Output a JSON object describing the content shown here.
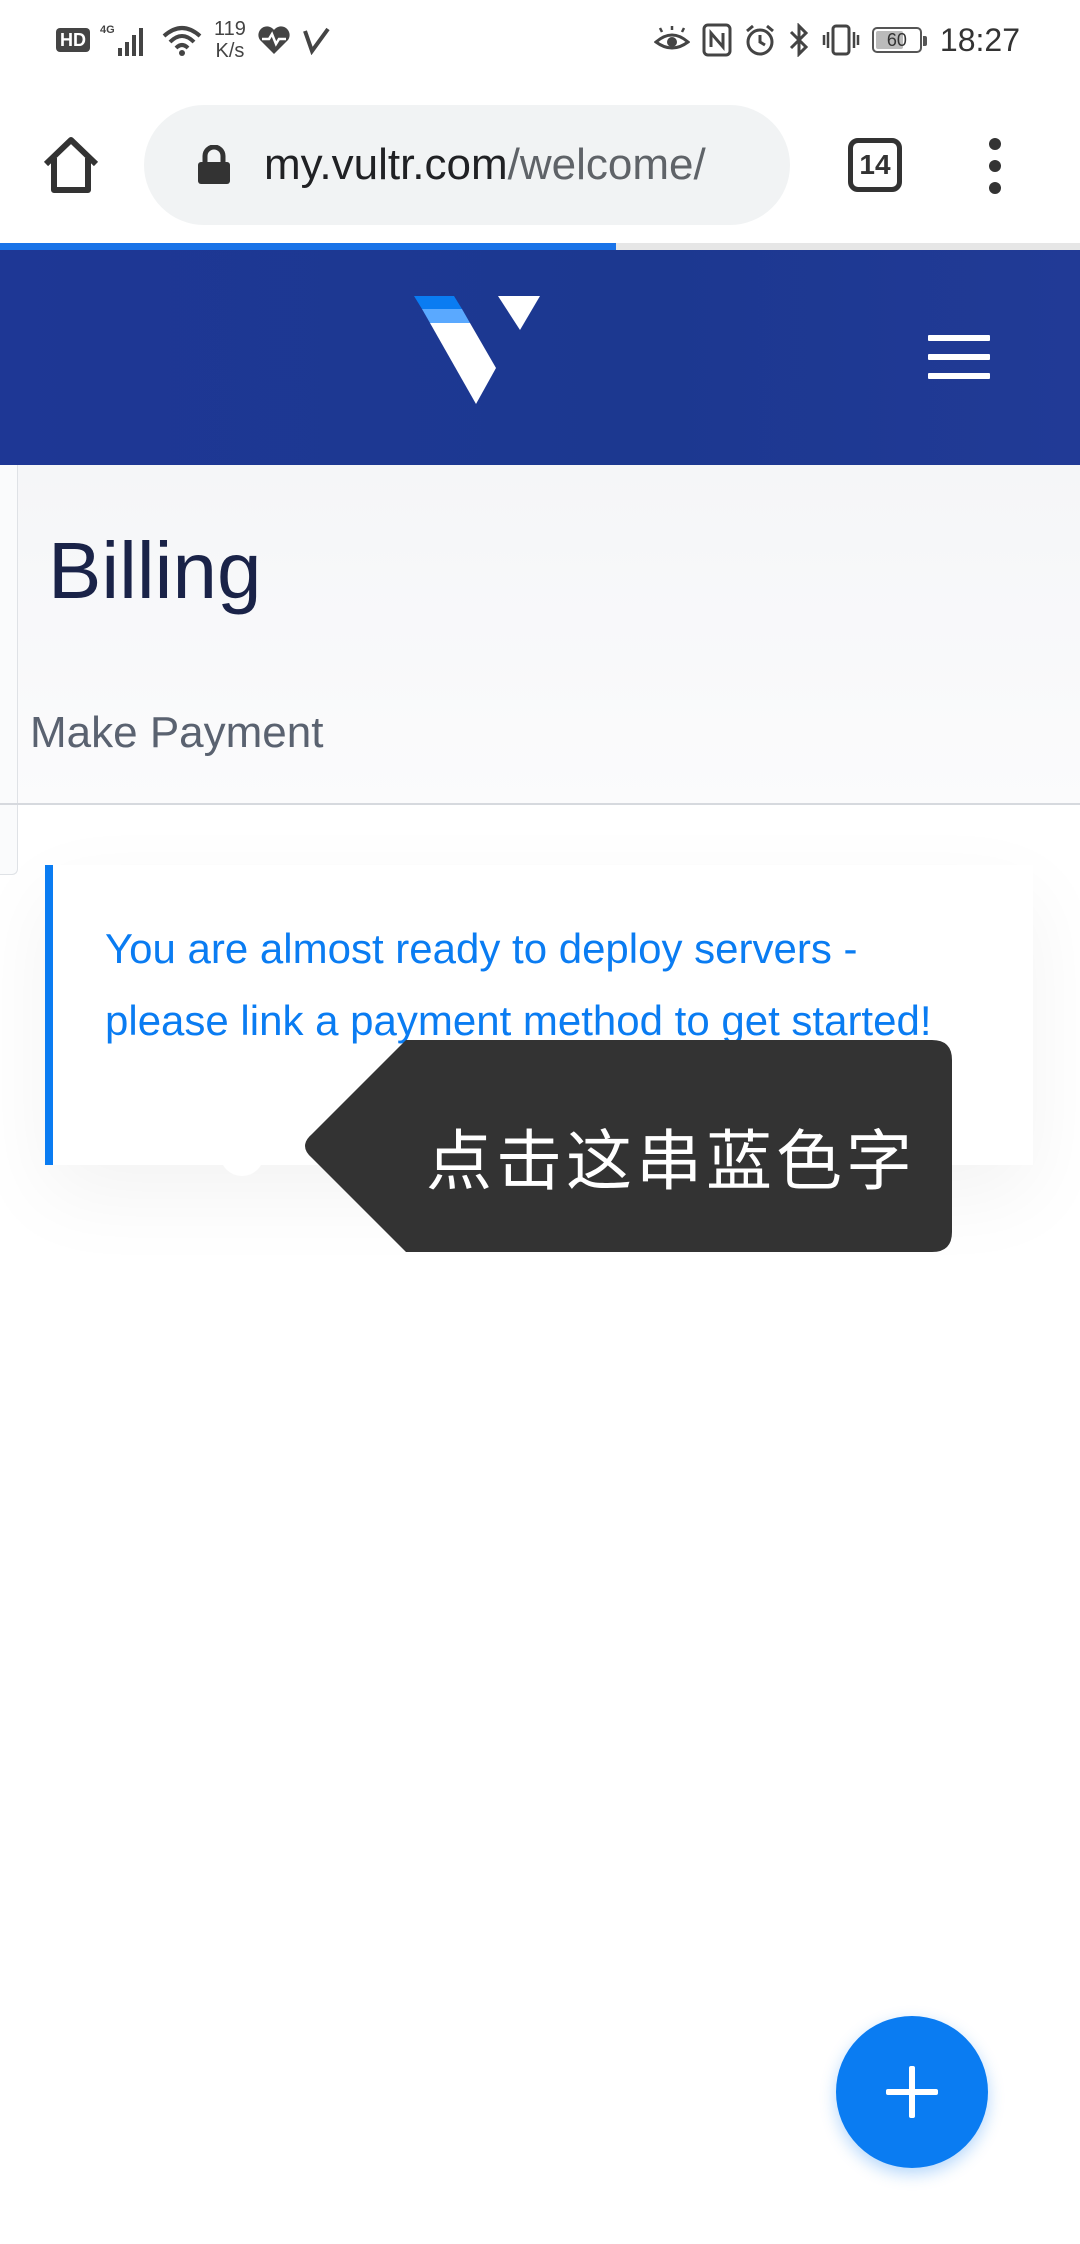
{
  "status_bar": {
    "hd": "HD",
    "network": "4G",
    "speed_value": "119",
    "speed_unit": "K/s",
    "battery": "60",
    "time": "18:27"
  },
  "browser": {
    "url_host": "my.vultr.com",
    "url_path": "/welcome/",
    "tab_count": "14",
    "load_progress_percent": 57,
    "progress_color": "#1a73e8"
  },
  "site": {
    "brand_color": "#1e3795",
    "logo_icon": "vultr-logo-icon",
    "menu_icon": "hamburger-icon"
  },
  "page": {
    "title": "Billing",
    "subnav_item": "Make Payment",
    "alert_message": "You are almost ready to deploy servers - please link a payment method to get started!",
    "accent_color": "#0a7cf2"
  },
  "annotation": {
    "tooltip_text": "点击这串蓝色字"
  },
  "fab": {
    "icon": "plus-icon"
  }
}
